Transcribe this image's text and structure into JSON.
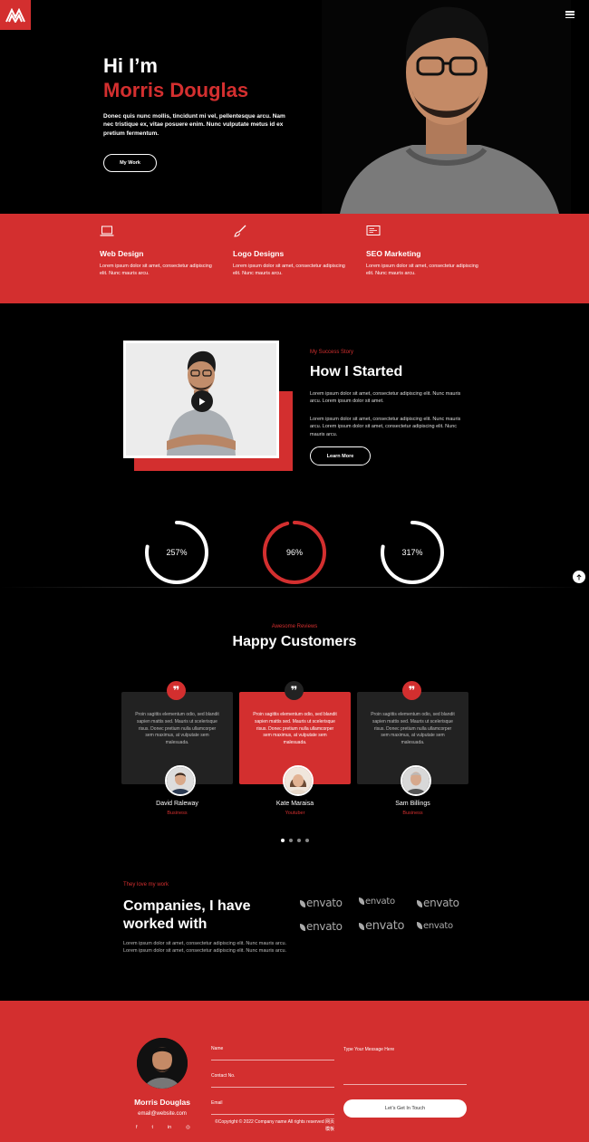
{
  "header": {
    "menu_icon": "hamburger-icon",
    "logo_icon": "m-logo-icon",
    "brand_color": "#d32f2f"
  },
  "hero": {
    "greeting": "Hi I’m",
    "name": "Morris Douglas",
    "text": "Donec quis nunc mollis, tincidunt mi vel, pellentesque arcu. Nam nec tristique ex, vitae posuere enim. Nunc vulputate metus id ex pretium fermentum.",
    "button": "My Work"
  },
  "services": [
    {
      "icon": "laptop-icon",
      "title": "Web Design",
      "desc": "Lorem ipsum dolor sit amet, consectetur adipiscing elit. Nunc mauris arcu."
    },
    {
      "icon": "paintbrush-icon",
      "title": "Logo Designs",
      "desc": "Lorem ipsum dolor sit amet, consectetur adipiscing elit. Nunc mauris arcu."
    },
    {
      "icon": "monitor-icon",
      "title": "SEO Marketing",
      "desc": "Lorem ipsum dolor sit amet, consectetur adipiscing elit. Nunc mauris arcu."
    }
  ],
  "story": {
    "eyebrow": "My Success Story",
    "title": "How I Started",
    "p1": "Lorem ipsum dolor sit amet, consectetur adipiscing elit. Nunc mauris arcu. Lorem ipsum dolor sit amet.",
    "p2": "Lorem ipsum dolor sit amet, consectetur adipiscing elit. Nunc mauris arcu. Lorem ipsum dolor sit amet, consectetur adipiscing elit. Nunc mauris arcu.",
    "button": "Learn More",
    "play_icon": "play-icon"
  },
  "stats": [
    {
      "label": "257%",
      "fraction": 0.78,
      "color": "#ffffff"
    },
    {
      "label": "96%",
      "fraction": 0.96,
      "color": "#d32f2f"
    },
    {
      "label": "317%",
      "fraction": 0.78,
      "color": "#ffffff"
    }
  ],
  "scroll_top_icon": "arrow-up-icon",
  "reviews": {
    "eyebrow": "Awesome Reviews",
    "title": "Happy Customers",
    "quote_glyph": "❞",
    "items": [
      {
        "text": "Proin sagittis elementum odio, sed blandit sapien mattis sed. Mauris ut scelerisque risus. Donec pretium nulla ullamcorper sem maximus, at vulputate sem malesuada.",
        "name": "David Raleway",
        "role": "Business"
      },
      {
        "text": "Proin sagittis elementum odio, sed blandit sapien mattis sed. Mauris ut scelerisque risus. Donec pretium nulla ullamcorper sem maximus, at vulputate sem malesuada.",
        "name": "Kate Maraisa",
        "role": "Youtuber"
      },
      {
        "text": "Proin sagittis elementum odio, sed blandit sapien mattis sed. Mauris ut scelerisque risus. Donec pretium nulla ullamcorper sem maximus, at vulputate sem malesuada.",
        "name": "Sam Billings",
        "role": "Business"
      }
    ],
    "active_dot": 0
  },
  "companies": {
    "eyebrow": "They love my work",
    "title": "Companies, I have worked with",
    "desc": "Lorem ipsum dolor sit amet, consectetur adipiscing elit. Nunc mauris arcu. Lorem ipsum dolor sit amet, consectetur adipiscing elit. Nunc mauris arcu.",
    "brands": [
      "envato",
      "envato",
      "envato",
      "envato",
      "envato",
      "envato"
    ]
  },
  "footer": {
    "name": "Morris Douglas",
    "email": "email@website.com",
    "social": [
      "f",
      "t",
      "in",
      "◎"
    ],
    "fields": [
      "Name",
      "Contact No.",
      "Email"
    ],
    "message_label": "Type Your Message Here",
    "button": "Let’s Get In Touch",
    "copyright": "©Copyright © 2022 Company name All rights reserved 网页模板"
  }
}
